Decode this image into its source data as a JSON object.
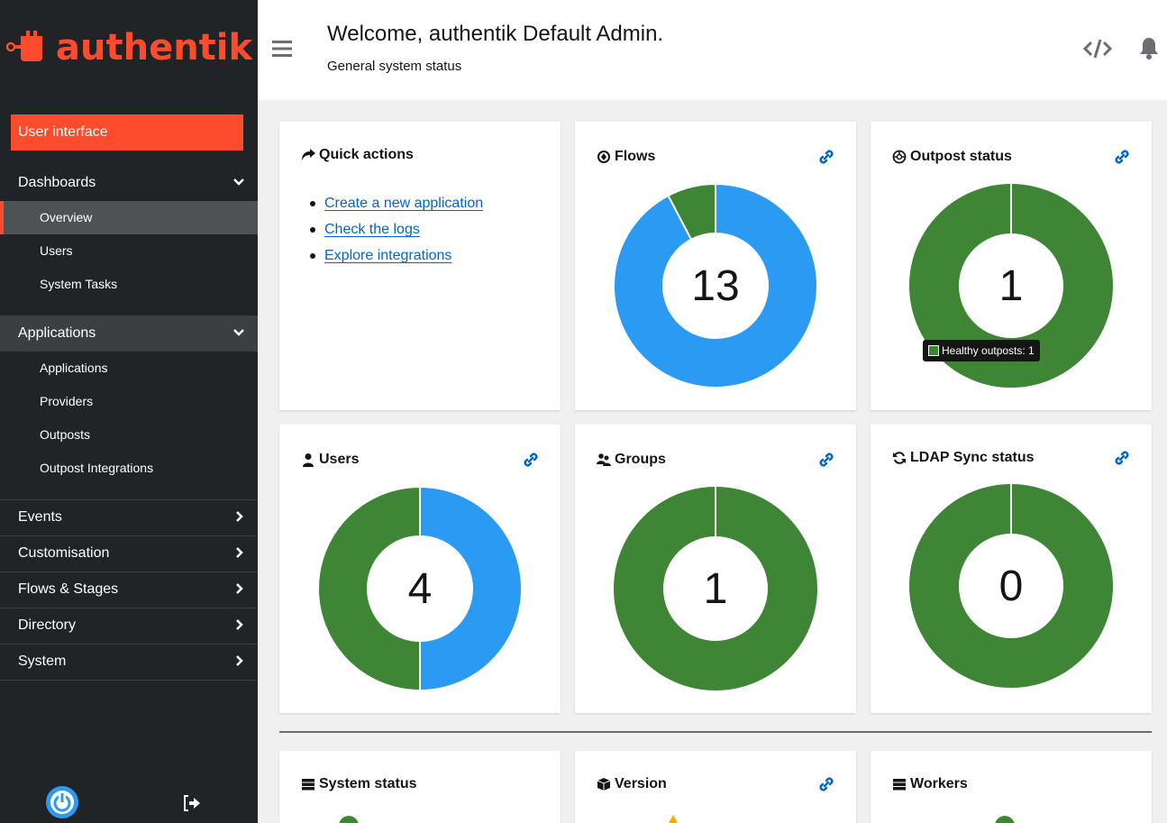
{
  "brand": {
    "name": "authentik",
    "color": "#fd4b2d"
  },
  "sidebar": {
    "ui_button": "User interface",
    "sections": [
      {
        "label": "Dashboards",
        "expanded": true,
        "items": [
          "Overview",
          "Users",
          "System Tasks"
        ],
        "current": "Overview"
      },
      {
        "label": "Applications",
        "expanded": true,
        "items": [
          "Applications",
          "Providers",
          "Outposts",
          "Outpost Integrations"
        ]
      },
      {
        "label": "Events",
        "expanded": false
      },
      {
        "label": "Customisation",
        "expanded": false
      },
      {
        "label": "Flows & Stages",
        "expanded": false
      },
      {
        "label": "Directory",
        "expanded": false
      },
      {
        "label": "System",
        "expanded": false
      }
    ]
  },
  "header": {
    "title": "Welcome, authentik Default Admin.",
    "subtitle": "General system status",
    "icons": [
      "menu-icon",
      "code-icon",
      "bell-icon"
    ]
  },
  "cards": {
    "quick_actions": {
      "title": "Quick actions",
      "links": [
        "Create a new application",
        "Check the logs",
        "Explore integrations"
      ]
    },
    "flows": {
      "title": "Flows",
      "total": "13"
    },
    "outposts": {
      "title": "Outpost status",
      "total": "1",
      "tooltip": "Healthy outposts: 1"
    },
    "users": {
      "title": "Users",
      "total": "4"
    },
    "groups": {
      "title": "Groups",
      "total": "1"
    },
    "ldap": {
      "title": "LDAP Sync status",
      "total": "0"
    },
    "system_status": {
      "title": "System status"
    },
    "version": {
      "title": "Version"
    },
    "workers": {
      "title": "Workers"
    }
  },
  "colors": {
    "green": "#3e8635",
    "blue": "#2b9af3",
    "sidebar_bg": "#212427"
  },
  "chart_data": [
    {
      "type": "pie",
      "title": "Flows",
      "categories": [
        "",
        ""
      ],
      "values": [
        12,
        1
      ],
      "colors": [
        "#2b9af3",
        "#3e8635"
      ]
    },
    {
      "type": "pie",
      "title": "Outpost status",
      "categories": [
        "Healthy outposts"
      ],
      "values": [
        1
      ],
      "colors": [
        "#3e8635"
      ]
    },
    {
      "type": "pie",
      "title": "Users",
      "categories": [
        "",
        ""
      ],
      "values": [
        2,
        2
      ],
      "colors": [
        "#2b9af3",
        "#3e8635"
      ]
    },
    {
      "type": "pie",
      "title": "Groups",
      "categories": [
        ""
      ],
      "values": [
        1
      ],
      "colors": [
        "#3e8635"
      ]
    },
    {
      "type": "pie",
      "title": "LDAP Sync status",
      "categories": [
        ""
      ],
      "values": [
        1
      ],
      "colors": [
        "#3e8635"
      ]
    }
  ]
}
